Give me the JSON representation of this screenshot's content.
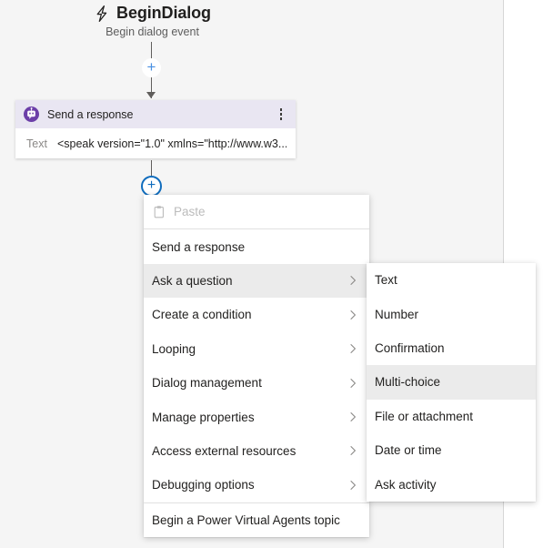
{
  "trigger": {
    "icon": "lightning-bolt-icon",
    "title": "BeginDialog",
    "subtitle": "Begin dialog event"
  },
  "action_card": {
    "icon": "bot-response-icon",
    "title": "Send a response",
    "overflow_icon": "more-vertical-icon",
    "body_label": "Text",
    "body_value": "<speak version=\"1.0\" xmlns=\"http://www.w3...."
  },
  "connectors": {
    "add_button_top": "+",
    "add_button_active": "+"
  },
  "context_menu": {
    "items": [
      {
        "label": "Paste",
        "icon": "clipboard-icon",
        "disabled": true,
        "submenu": false,
        "highlight": false,
        "divider_after": true
      },
      {
        "label": "Send a response",
        "icon": null,
        "disabled": false,
        "submenu": false,
        "highlight": false,
        "divider_after": false
      },
      {
        "label": "Ask a question",
        "icon": null,
        "disabled": false,
        "submenu": true,
        "highlight": true,
        "divider_after": false
      },
      {
        "label": "Create a condition",
        "icon": null,
        "disabled": false,
        "submenu": true,
        "highlight": false,
        "divider_after": false
      },
      {
        "label": "Looping",
        "icon": null,
        "disabled": false,
        "submenu": true,
        "highlight": false,
        "divider_after": false
      },
      {
        "label": "Dialog management",
        "icon": null,
        "disabled": false,
        "submenu": true,
        "highlight": false,
        "divider_after": false
      },
      {
        "label": "Manage properties",
        "icon": null,
        "disabled": false,
        "submenu": true,
        "highlight": false,
        "divider_after": false
      },
      {
        "label": "Access external resources",
        "icon": null,
        "disabled": false,
        "submenu": true,
        "highlight": false,
        "divider_after": false
      },
      {
        "label": "Debugging options",
        "icon": null,
        "disabled": false,
        "submenu": true,
        "highlight": false,
        "divider_after": true
      },
      {
        "label": "Begin a Power Virtual Agents topic",
        "icon": null,
        "disabled": false,
        "submenu": false,
        "highlight": false,
        "divider_after": false
      }
    ]
  },
  "sub_menu": {
    "parent": "Ask a question",
    "items": [
      {
        "label": "Text",
        "highlight": false
      },
      {
        "label": "Number",
        "highlight": false
      },
      {
        "label": "Confirmation",
        "highlight": false
      },
      {
        "label": "Multi-choice",
        "highlight": true
      },
      {
        "label": "File or attachment",
        "highlight": false
      },
      {
        "label": "Date or time",
        "highlight": false
      },
      {
        "label": "Ask activity",
        "highlight": false
      }
    ]
  },
  "colors": {
    "canvas_background": "#f5f5f5",
    "card_header": "#e9e6f2",
    "bot_icon": "#6c3fa8",
    "accent_blue": "#0f6cbd",
    "menu_highlight": "#ebebeb",
    "text_primary": "#201f1e",
    "text_disabled": "#bcbcbc"
  }
}
